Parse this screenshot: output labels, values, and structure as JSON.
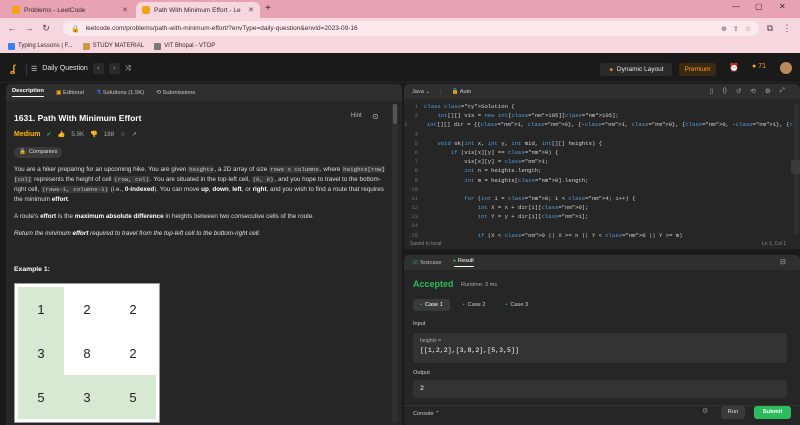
{
  "browser": {
    "tabs": [
      {
        "label": "Problems - LeetCode"
      },
      {
        "label": "Path With Minimum Effort - Le"
      }
    ],
    "new_tab": "+",
    "url": "leetcode.com/problems/path-with-minimum-effort/?envType=daily-question&envId=2023-09-16",
    "bookmarks": [
      "Typing Lessons | F...",
      "STUDY MATERIAL",
      "VIT Bhopal - VTOP"
    ]
  },
  "nav": {
    "daily_question": "Daily Question",
    "dynamic_layout": "Dynamic Layout",
    "premium": "Premium",
    "streak": "71"
  },
  "left": {
    "tabs": [
      "Description",
      "Editorial",
      "Solutions (1.5K)",
      "Submissions"
    ],
    "title": "1631. Path With Minimum Effort",
    "hint": "Hint",
    "difficulty": "Medium",
    "likes": "5.9K",
    "dislikes": "188",
    "companies": "Companies",
    "desc": {
      "p1_a": "You are a hiker preparing for an upcoming hike. You are given ",
      "p1_heights": "heights",
      "p1_b": ", a 2D array of size ",
      "p1_size": "rows x columns",
      "p1_c": ", where ",
      "p1_hrc": "heights[row][col]",
      "p1_d": " represents the height of cell ",
      "p1_rc": "(row, col)",
      "p1_e": ". You are situated in the top-left cell, ",
      "p1_00": "(0, 0)",
      "p1_f": ", and you hope to travel to the bottom-right cell, ",
      "p1_end": "(rows-1, columns-1)",
      "p1_g": " (i.e., ",
      "p1_zero": "0-indexed",
      "p1_h": "). You can move ",
      "p1_up": "up",
      "p1_down": "down",
      "p1_left": "left",
      "p1_or": ", or ",
      "p1_right": "right",
      "p1_i": ", and you wish to find a route that requires the minimum ",
      "p1_effort": "effort",
      "comma": ", ",
      "period": ".",
      "p2_a": "A route's ",
      "p2_effort": "effort",
      "p2_b": " is the ",
      "p2_max": "maximum absolute difference",
      "p2_c": " in heights between two consecutive cells of the route.",
      "p3_a": "Return ",
      "p3_b": "the minimum ",
      "p3_effort": "effort",
      "p3_c": " required to travel from the top-left cell to the bottom-right cell."
    },
    "example_title": "Example 1:",
    "grid": [
      {
        "v": "1",
        "hl": true
      },
      {
        "v": "2",
        "hl": false
      },
      {
        "v": "2",
        "hl": false
      },
      {
        "v": "3",
        "hl": true
      },
      {
        "v": "8",
        "hl": false
      },
      {
        "v": "2",
        "hl": false
      },
      {
        "v": "5",
        "hl": true
      },
      {
        "v": "3",
        "hl": true
      },
      {
        "v": "5",
        "hl": true
      }
    ]
  },
  "editor": {
    "language": "Java",
    "mode": "Auto",
    "saved": "Saved to local",
    "position": "Ln 1, Col 1",
    "lines": [
      {
        "n": "1",
        "t": "class Solution {"
      },
      {
        "n": "2",
        "t": "    int[][] vis = new int[105][105];"
      },
      {
        "n": "3",
        "t": "    int[][] dir = {{1, 0}, {-1, 0}, {0, -1}, {0, 1}};"
      },
      {
        "n": "4",
        "t": ""
      },
      {
        "n": "5",
        "t": "    void ok(int x, int y, int mid, int[][] heights) {"
      },
      {
        "n": "6",
        "t": "        if (vis[x][y] == 0) {"
      },
      {
        "n": "7",
        "t": "            vis[x][y] = 1;"
      },
      {
        "n": "8",
        "t": "            int n = heights.length;"
      },
      {
        "n": "9",
        "t": "            int m = heights[0].length;"
      },
      {
        "n": "10",
        "t": ""
      },
      {
        "n": "11",
        "t": "            for (int i = 0; i < 4; i++) {"
      },
      {
        "n": "12",
        "t": "                int X = x + dir[i][0];"
      },
      {
        "n": "13",
        "t": "                int Y = y + dir[i][1];"
      },
      {
        "n": "14",
        "t": ""
      },
      {
        "n": "15",
        "t": "                if (X < 0 || X >= n || Y < 0 || Y >= m)"
      }
    ]
  },
  "result": {
    "tabs": [
      "Testcase",
      "Result"
    ],
    "status": "Accepted",
    "runtime": "Runtime: 3 ms",
    "cases": [
      "Case 1",
      "Case 2",
      "Case 3"
    ],
    "input_label": "Input",
    "input_var": "heights =",
    "input_value": "[[1,2,2],[3,8,2],[5,3,5]]",
    "output_label": "Output",
    "output_value": "2",
    "console": "Console",
    "run": "Run",
    "submit": "Submit"
  },
  "colors": {
    "accent": "#ffa116",
    "accepted": "#2cbb5d",
    "medium": "#ffb800"
  }
}
